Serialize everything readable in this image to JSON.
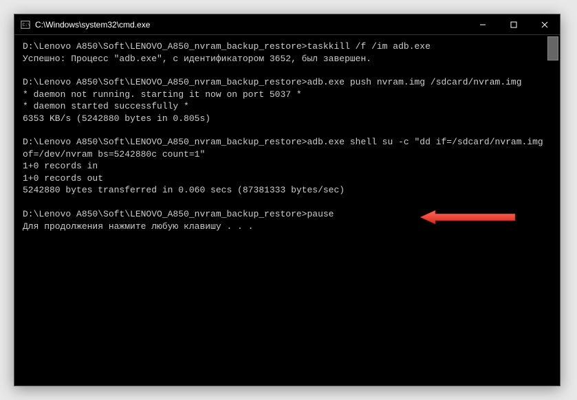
{
  "titlebar": {
    "title": "C:\\Windows\\system32\\cmd.exe",
    "minimize": "—",
    "maximize": "□",
    "close": "✕"
  },
  "terminal": {
    "block1": {
      "line1": "D:\\Lenovo A850\\Soft\\LENOVO_A850_nvram_backup_restore>taskkill /f /im adb.exe",
      "line2": "Успешно: Процесс \"adb.exe\", с идентификатором 3652, был завершен."
    },
    "block2": {
      "line1": "D:\\Lenovo A850\\Soft\\LENOVO_A850_nvram_backup_restore>adb.exe push nvram.img /sdcard/nvram.img",
      "line2": "* daemon not running. starting it now on port 5037 *",
      "line3": "* daemon started successfully *",
      "line4": "6353 KB/s (5242880 bytes in 0.805s)"
    },
    "block3": {
      "line1": "D:\\Lenovo A850\\Soft\\LENOVO_A850_nvram_backup_restore>adb.exe shell su -c \"dd if=/sdcard/nvram.img of=/dev/nvram bs=5242880c count=1\"",
      "line2": "1+0 records in",
      "line3": "1+0 records out",
      "line4": "5242880 bytes transferred in 0.060 secs (87381333 bytes/sec)"
    },
    "block4": {
      "line1": "D:\\Lenovo A850\\Soft\\LENOVO_A850_nvram_backup_restore>pause",
      "line2": "Для продолжения нажмите любую клавишу . . ."
    }
  }
}
